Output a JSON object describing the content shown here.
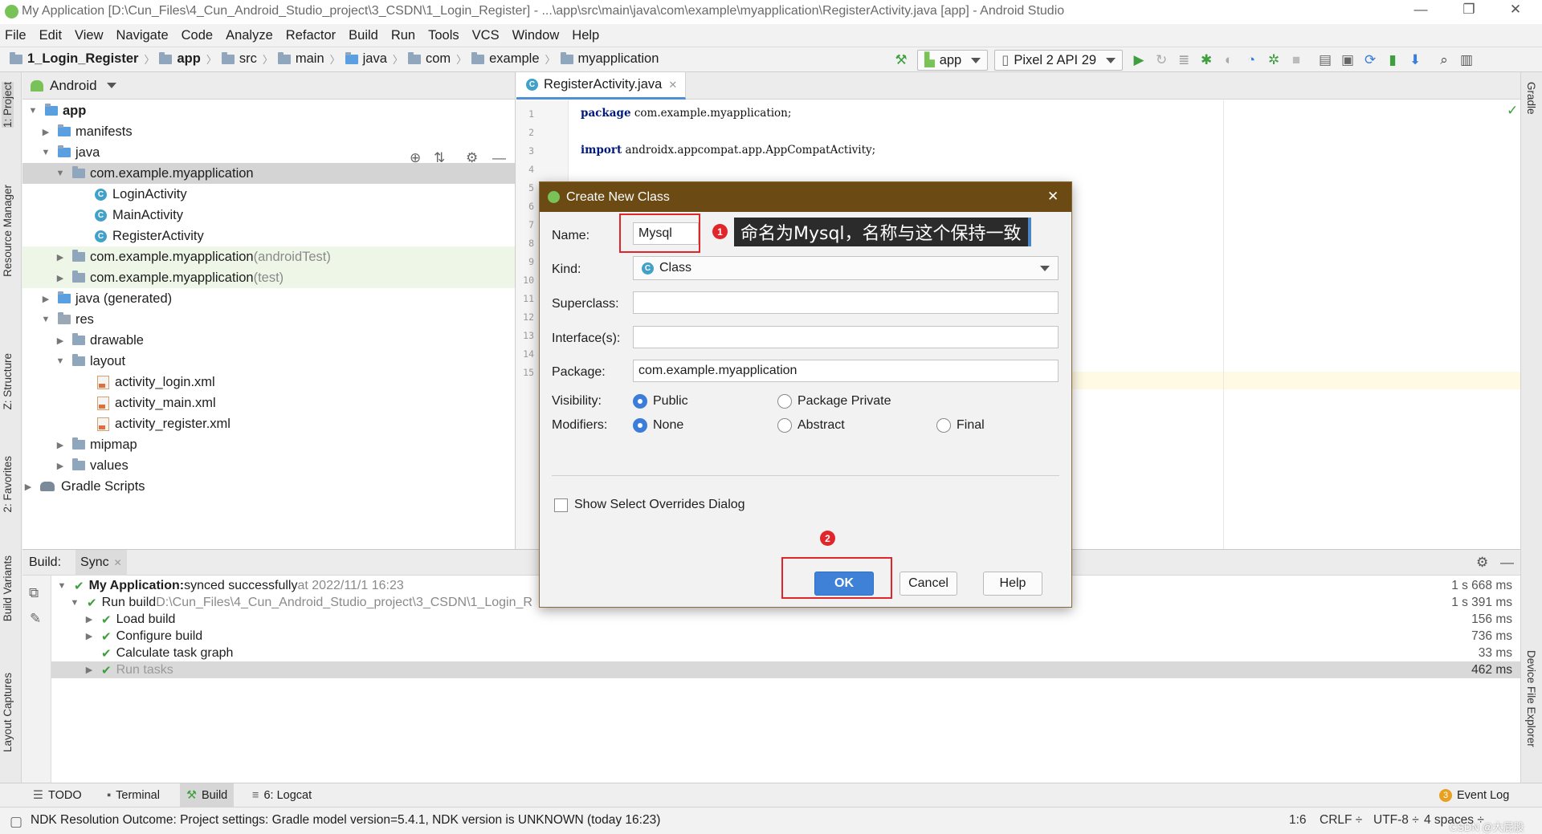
{
  "window": {
    "title": "My Application [D:\\Cun_Files\\4_Cun_Android_Studio_project\\3_CSDN\\1_Login_Register] - ...\\app\\src\\main\\java\\com\\example\\myapplication\\RegisterActivity.java [app] - Android Studio",
    "minimize": "—",
    "restore": "❐",
    "close": "✕"
  },
  "menu": [
    "File",
    "Edit",
    "View",
    "Navigate",
    "Code",
    "Analyze",
    "Refactor",
    "Build",
    "Run",
    "Tools",
    "VCS",
    "Window",
    "Help"
  ],
  "breadcrumb": [
    "1_Login_Register",
    "app",
    "src",
    "main",
    "java",
    "com",
    "example",
    "myapplication"
  ],
  "toolbar": {
    "module": "app",
    "device": "Pixel 2 API 29"
  },
  "left_tabs": {
    "project": "1: Project",
    "resource_manager": "Resource Manager",
    "structure": "Z: Structure",
    "favorites": "2: Favorites",
    "build_variants": "Build Variants",
    "layout_captures": "Layout Captures"
  },
  "right_tabs": {
    "gradle": "Gradle",
    "device_file_explorer": "Device File Explorer"
  },
  "project": {
    "view": "Android",
    "tree": [
      {
        "label": "app",
        "suffix": ""
      },
      {
        "label": "manifests",
        "suffix": ""
      },
      {
        "label": "java",
        "suffix": ""
      },
      {
        "label": "com.example.myapplication",
        "suffix": ""
      },
      {
        "label": "LoginActivity",
        "suffix": ""
      },
      {
        "label": "MainActivity",
        "suffix": ""
      },
      {
        "label": "RegisterActivity",
        "suffix": ""
      },
      {
        "label": "com.example.myapplication",
        "suffix": " (androidTest)"
      },
      {
        "label": "com.example.myapplication",
        "suffix": " (test)"
      },
      {
        "label": "java (generated)",
        "suffix": ""
      },
      {
        "label": "res",
        "suffix": ""
      },
      {
        "label": "drawable",
        "suffix": ""
      },
      {
        "label": "layout",
        "suffix": ""
      },
      {
        "label": "activity_login.xml",
        "suffix": ""
      },
      {
        "label": "activity_main.xml",
        "suffix": ""
      },
      {
        "label": "activity_register.xml",
        "suffix": ""
      },
      {
        "label": "mipmap",
        "suffix": ""
      },
      {
        "label": "values",
        "suffix": ""
      },
      {
        "label": "Gradle Scripts",
        "suffix": ""
      }
    ]
  },
  "editor": {
    "tab": "RegisterActivity.java",
    "line_numbers": [
      "1",
      "2",
      "3",
      "4",
      "5",
      "6",
      "7",
      "8",
      "9",
      "10",
      "11",
      "12",
      "13",
      "14",
      "15"
    ],
    "line1_kw": "package",
    "line1_rest": " com.example.myapplication;",
    "line3_kw": "import",
    "line3_rest": " androidx.appcompat.app.AppCompatActivity;"
  },
  "dialog": {
    "title": "Create New Class",
    "name_label": "Name:",
    "name_value": "Mysql",
    "kind_label": "Kind:",
    "kind_value": "Class",
    "superclass_label": "Superclass:",
    "interfaces_label": "Interface(s):",
    "package_label": "Package:",
    "package_value": "com.example.myapplication",
    "visibility_label": "Visibility:",
    "visibility_options": [
      "Public",
      "Package Private"
    ],
    "modifiers_label": "Modifiers:",
    "modifier_options": [
      "None",
      "Abstract",
      "Final"
    ],
    "overrides_label": "Show Select Overrides Dialog",
    "ok": "OK",
    "cancel": "Cancel",
    "help": "Help"
  },
  "annotations": {
    "badge1": "1",
    "badge2": "2",
    "callout": "命名为Mysql，名称与这个保持一致",
    "color": "#e0252b"
  },
  "build": {
    "title": "Build:",
    "tab": "Sync",
    "rows": [
      {
        "bold": "My Application:",
        "text": " synced successfully",
        "muted": " at 2022/11/1 16:23",
        "time": "1 s 668 ms"
      },
      {
        "bold": "",
        "text": "Run build",
        "muted": " D:\\Cun_Files\\4_Cun_Android_Studio_project\\3_CSDN\\1_Login_R",
        "time": "1 s 391 ms"
      },
      {
        "bold": "",
        "text": "Load build",
        "muted": "",
        "time": "156 ms"
      },
      {
        "bold": "",
        "text": "Configure build",
        "muted": "",
        "time": "736 ms"
      },
      {
        "bold": "",
        "text": "Calculate task graph",
        "muted": "",
        "time": "33 ms"
      },
      {
        "bold": "",
        "text": "Run tasks",
        "muted": "",
        "time": "462 ms"
      }
    ]
  },
  "bottom_tabs": {
    "todo": "TODO",
    "terminal": "Terminal",
    "build": "Build",
    "logcat": "6: Logcat",
    "event_log": "Event Log",
    "event_count": "3"
  },
  "status": {
    "message": "NDK Resolution Outcome: Project settings: Gradle model version=5.4.1, NDK version is UNKNOWN (today 16:23)",
    "position": "1:6",
    "line_sep": "CRLF ÷",
    "encoding": "UTF-8 ÷",
    "indent": "4 spaces ÷",
    "watermark": "CSDN @大屁股"
  },
  "colors": {
    "dialog_title_bg": "#6b4a14",
    "accent_blue": "#3f81d6",
    "success_green": "#3d9f3d"
  }
}
